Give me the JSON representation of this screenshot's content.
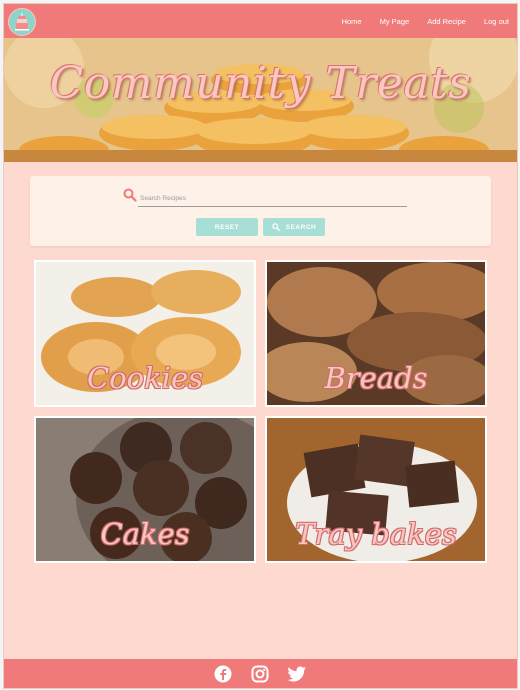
{
  "nav": {
    "links": [
      "Home",
      "My Page",
      "Add Recipe",
      "Log out"
    ]
  },
  "hero": {
    "title": "Community Treats"
  },
  "search": {
    "placeholder": "Search Recipes",
    "reset_label": "RESET",
    "search_label": "SEARCH"
  },
  "categories": [
    {
      "label": "Cookies"
    },
    {
      "label": "Breads"
    },
    {
      "label": "Cakes"
    },
    {
      "label": "Tray bakes"
    }
  ],
  "footer": {
    "icons": [
      "facebook-icon",
      "instagram-icon",
      "twitter-icon"
    ]
  },
  "colors": {
    "navbar": "#ef7a79",
    "page_bg": "#fdd9cf",
    "button": "#a7ded6",
    "accent": "#f9c8c0"
  }
}
